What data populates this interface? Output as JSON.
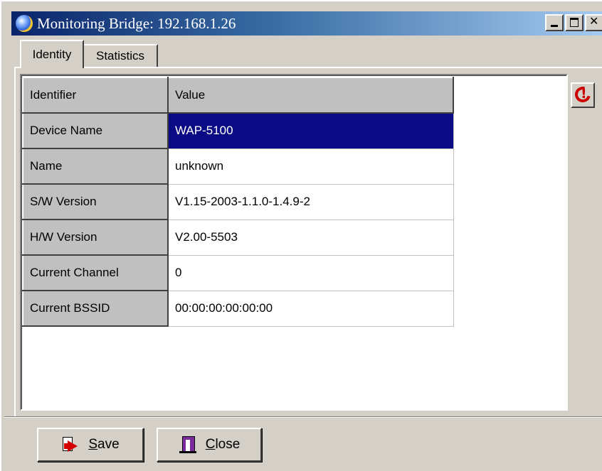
{
  "window": {
    "title": "Monitoring Bridge: 192.168.1.26"
  },
  "tabs": [
    {
      "label": "Identity",
      "active": true
    },
    {
      "label": "Statistics",
      "active": false
    }
  ],
  "grid": {
    "columns": [
      "Identifier",
      "Value"
    ],
    "rows": [
      {
        "identifier": "Device Name",
        "value": "WAP-5100",
        "selected": true
      },
      {
        "identifier": "Name",
        "value": "unknown",
        "selected": false
      },
      {
        "identifier": "S/W Version",
        "value": "V1.15-2003-1.1.0-1.4.9-2",
        "selected": false
      },
      {
        "identifier": "H/W Version",
        "value": "V2.00-5503",
        "selected": false
      },
      {
        "identifier": "Current Channel",
        "value": "0",
        "selected": false
      },
      {
        "identifier": "Current BSSID",
        "value": "00:00:00:00:00:00",
        "selected": false
      }
    ]
  },
  "buttons": {
    "save_mnemonic": "S",
    "save_rest": "ave",
    "close_mnemonic": "C",
    "close_rest": "lose"
  },
  "icons": {
    "app": "globe-icon",
    "refresh": "refresh-alert-icon",
    "save": "save-arrow-icon",
    "close": "exit-door-icon"
  },
  "colors": {
    "selection": "#0a0a84",
    "titlebar_start": "#0a246a",
    "face": "#d4d0c8"
  }
}
